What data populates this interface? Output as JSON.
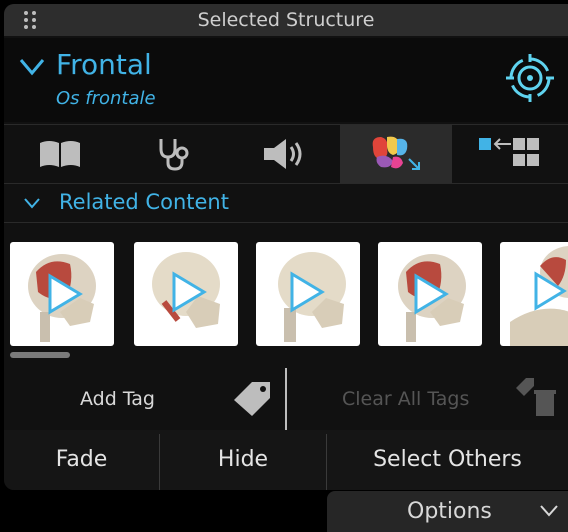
{
  "titlebar": {
    "title": "Selected Structure"
  },
  "structure": {
    "name": "Frontal",
    "latin_name": "Os frontale"
  },
  "toolbar": {
    "buttons": [
      "book-icon",
      "stethoscope-icon",
      "speaker-icon",
      "anatomy-regions-icon",
      "layer-grid-icon"
    ],
    "active": "anatomy-regions-icon"
  },
  "related": {
    "label": "Related Content"
  },
  "tags": {
    "add_label": "Add Tag",
    "clear_label": "Clear All Tags"
  },
  "actions": {
    "fade": "Fade",
    "hide": "Hide",
    "select_others": "Select Others"
  },
  "options": {
    "label": "Options"
  },
  "colors": {
    "accent": "#41b3e6",
    "panel": "#111111",
    "titlebar": "#2d2d2d"
  }
}
